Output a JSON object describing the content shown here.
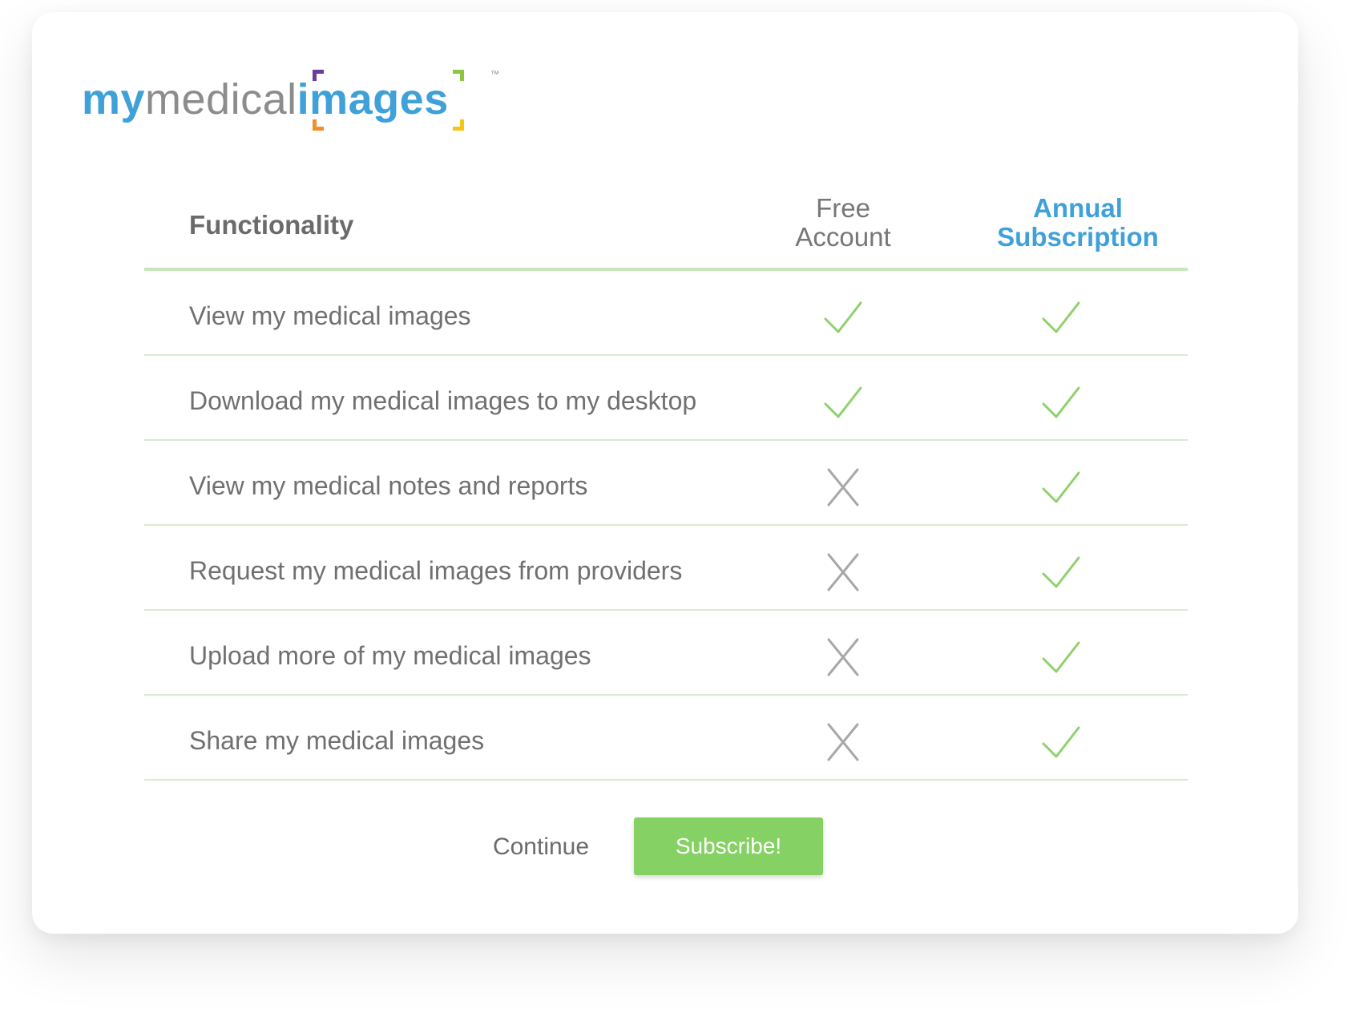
{
  "logo": {
    "part_my": "my",
    "part_medical": "medical",
    "part_images": "images",
    "trademark": "™",
    "colors": {
      "blue": "#3fa1d8",
      "gray": "#8c8c8c",
      "purple": "#6a3d96",
      "green": "#8cc63f",
      "orange": "#f18f2c",
      "yellow": "#f5c518"
    }
  },
  "table": {
    "header": {
      "functionality": "Functionality",
      "free_account": "Free Account",
      "annual_subscription": "Annual Subscription"
    },
    "rows": [
      {
        "label": "View my medical images",
        "free": "check",
        "annual": "check"
      },
      {
        "label": "Download my medical images to my desktop",
        "free": "check",
        "annual": "check"
      },
      {
        "label": "View my medical notes and reports",
        "free": "cross",
        "annual": "check"
      },
      {
        "label": "Request my medical images from providers",
        "free": "cross",
        "annual": "check"
      },
      {
        "label": "Upload more of my medical images",
        "free": "cross",
        "annual": "check"
      },
      {
        "label": "Share my medical images",
        "free": "cross",
        "annual": "check"
      }
    ]
  },
  "actions": {
    "continue_label": "Continue",
    "subscribe_label": "Subscribe!"
  },
  "colors": {
    "accent_blue": "#3fa1d8",
    "check_green": "#8fd16d",
    "cross_gray": "#a8a8a8",
    "button_green": "#86d163",
    "divider_green": "#d6ecce"
  },
  "icons": {
    "check": "check-icon",
    "cross": "cross-icon"
  }
}
